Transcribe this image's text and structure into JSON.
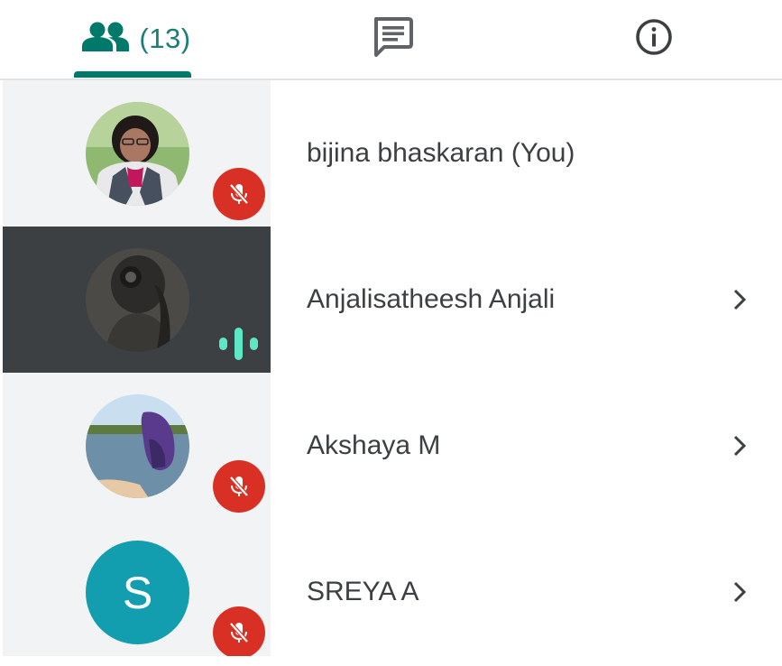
{
  "tabs": {
    "people": {
      "icon": "people-icon",
      "count_label": "(13)",
      "active": true
    },
    "chat": {
      "icon": "chat-icon",
      "active": false
    },
    "info": {
      "icon": "info-icon",
      "active": false
    }
  },
  "participants": [
    {
      "name": "bijina bhaskaran (You)",
      "avatar": "photo",
      "status": "muted",
      "has_chevron": false,
      "highlighted": false
    },
    {
      "name": "Anjalisatheesh Anjali",
      "avatar": "photo",
      "status": "speaking",
      "has_chevron": true,
      "highlighted": true
    },
    {
      "name": "Akshaya M",
      "avatar": "photo",
      "status": "muted",
      "has_chevron": true,
      "highlighted": false
    },
    {
      "name": "SREYA A",
      "avatar": "initial",
      "avatar_initial": "S",
      "status": "muted",
      "has_chevron": true,
      "highlighted": false
    }
  ],
  "colors": {
    "accent": "#00796b",
    "avatar_cell_bg": "#f1f3f4",
    "highlight_bg": "#3c4043",
    "mute_red": "#d93025",
    "speaking_teal": "#5ee7c5",
    "initial_avatar_bg": "#129eaf",
    "text": "#3c4043"
  }
}
